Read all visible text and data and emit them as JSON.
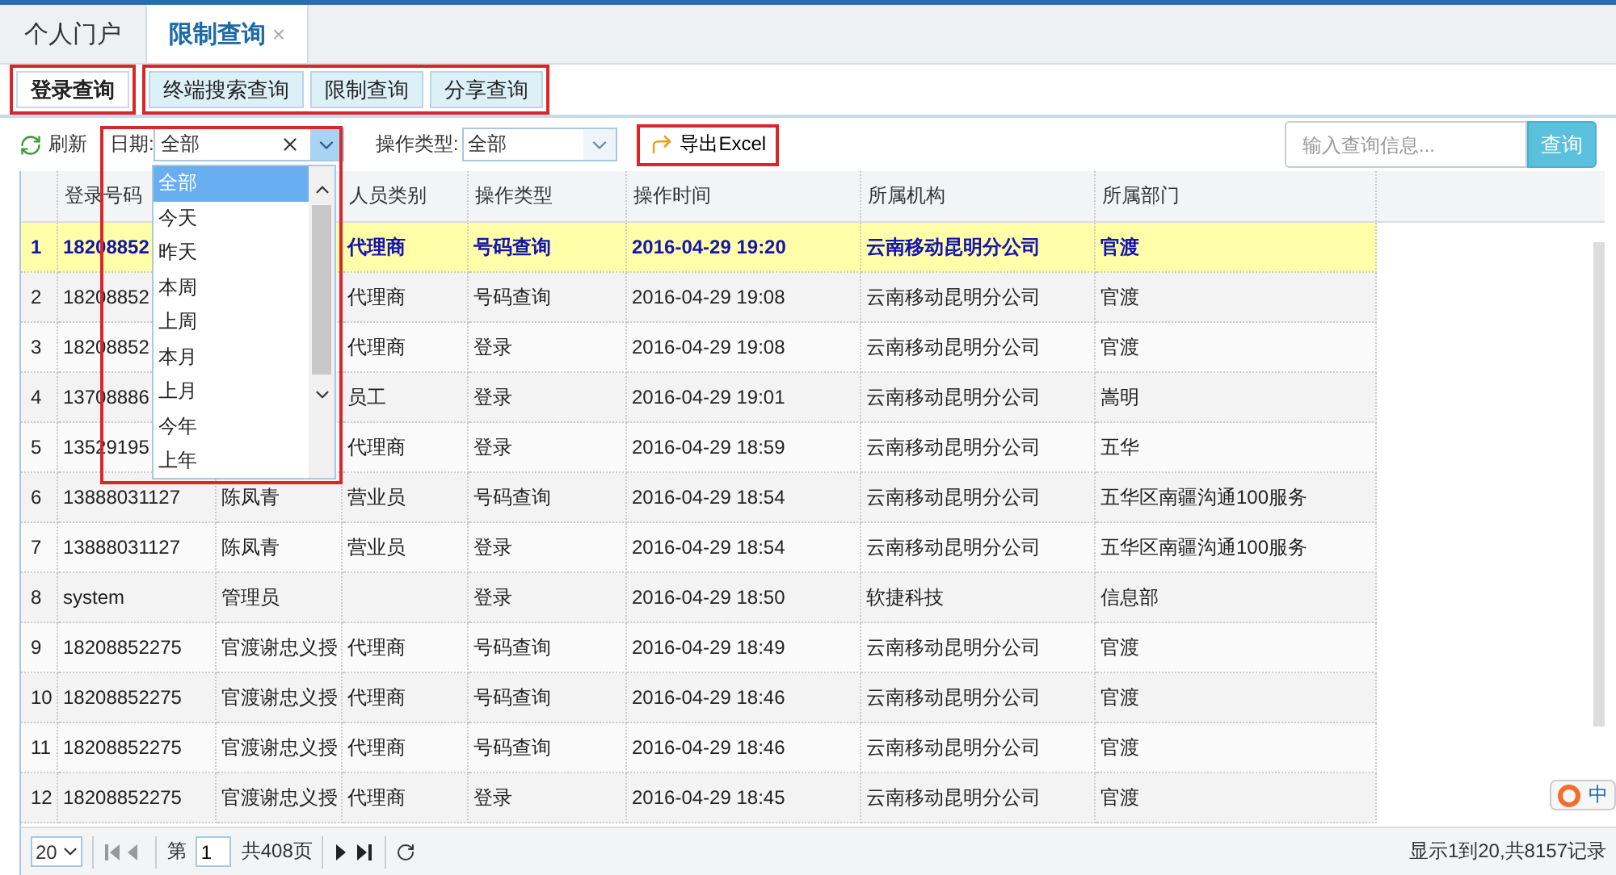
{
  "tabs": [
    {
      "label": "个人门户",
      "selected": false,
      "closable": false
    },
    {
      "label": "限制查询",
      "selected": true,
      "closable": true,
      "close": "×"
    }
  ],
  "subtabs": [
    {
      "label": "登录查询",
      "selected": true
    },
    {
      "label": "终端搜索查询",
      "selected": false
    },
    {
      "label": "限制查询",
      "selected": false
    },
    {
      "label": "分享查询",
      "selected": false
    }
  ],
  "toolbar": {
    "refresh": "刷新",
    "date_label": "日期:",
    "date_value": "全部",
    "type_label": "操作类型:",
    "type_value": "全部",
    "export": "导出Excel",
    "search_placeholder": "输入查询信息...",
    "search_button": "查询"
  },
  "date_options": [
    {
      "label": "全部",
      "selected": true
    },
    {
      "label": "今天",
      "selected": false
    },
    {
      "label": "昨天",
      "selected": false
    },
    {
      "label": "本周",
      "selected": false
    },
    {
      "label": "上周",
      "selected": false
    },
    {
      "label": "本月",
      "selected": false
    },
    {
      "label": "上月",
      "selected": false
    },
    {
      "label": "今年",
      "selected": false
    },
    {
      "label": "上年",
      "selected": false
    }
  ],
  "table": {
    "columns": [
      "登录号码",
      "人员类别",
      "操作类型",
      "操作时间",
      "所属机构",
      "所属部门"
    ],
    "rows": [
      {
        "n": "1",
        "login": "18208852",
        "type": "代理商",
        "op": "号码查询",
        "time": "2016-04-29 19:20",
        "org": "云南移动昆明分公司",
        "dept": "官渡",
        "selected": true
      },
      {
        "n": "2",
        "login": "18208852",
        "type": "代理商",
        "op": "号码查询",
        "time": "2016-04-29 19:08",
        "org": "云南移动昆明分公司",
        "dept": "官渡",
        "selected": false
      },
      {
        "n": "3",
        "login": "18208852",
        "type": "代理商",
        "op": "登录",
        "time": "2016-04-29 19:08",
        "org": "云南移动昆明分公司",
        "dept": "官渡",
        "selected": false
      },
      {
        "n": "4",
        "login": "13708886",
        "type": "员工",
        "op": "登录",
        "time": "2016-04-29 19:01",
        "org": "云南移动昆明分公司",
        "dept": "嵩明",
        "selected": false
      },
      {
        "n": "5",
        "login": "13529195",
        "type": "代理商",
        "op": "登录",
        "time": "2016-04-29 18:59",
        "org": "云南移动昆明分公司",
        "dept": "五华",
        "selected": false
      },
      {
        "n": "6",
        "login": "13888031127",
        "name": "陈凤青",
        "type": "营业员",
        "op": "号码查询",
        "time": "2016-04-29 18:54",
        "org": "云南移动昆明分公司",
        "dept": "五华区南疆沟通100服务",
        "selected": false
      },
      {
        "n": "7",
        "login": "13888031127",
        "name": "陈凤青",
        "type": "营业员",
        "op": "登录",
        "time": "2016-04-29 18:54",
        "org": "云南移动昆明分公司",
        "dept": "五华区南疆沟通100服务",
        "selected": false
      },
      {
        "n": "8",
        "login": "system",
        "name": "管理员",
        "op": "登录",
        "time": "2016-04-29 18:50",
        "org": "软捷科技",
        "dept": "信息部",
        "selected": false
      },
      {
        "n": "9",
        "login": "18208852275",
        "name": "官渡谢忠义授",
        "type": "代理商",
        "op": "号码查询",
        "time": "2016-04-29 18:49",
        "org": "云南移动昆明分公司",
        "dept": "官渡",
        "selected": false
      },
      {
        "n": "10",
        "login": "18208852275",
        "name": "官渡谢忠义授",
        "type": "代理商",
        "op": "号码查询",
        "time": "2016-04-29 18:46",
        "org": "云南移动昆明分公司",
        "dept": "官渡",
        "selected": false
      },
      {
        "n": "11",
        "login": "18208852275",
        "name": "官渡谢忠义授",
        "type": "代理商",
        "op": "号码查询",
        "time": "2016-04-29 18:46",
        "org": "云南移动昆明分公司",
        "dept": "官渡",
        "selected": false
      },
      {
        "n": "12",
        "login": "18208852275",
        "name": "官渡谢忠义授",
        "type": "代理商",
        "op": "登录",
        "time": "2016-04-29 18:45",
        "org": "云南移动昆明分公司",
        "dept": "官渡",
        "selected": false
      }
    ]
  },
  "pager": {
    "page_size": "20",
    "page_prefix": "第",
    "page": "1",
    "page_total": "共408页",
    "summary": "显示1到20,共8157记录"
  },
  "ime": {
    "label": "中"
  }
}
